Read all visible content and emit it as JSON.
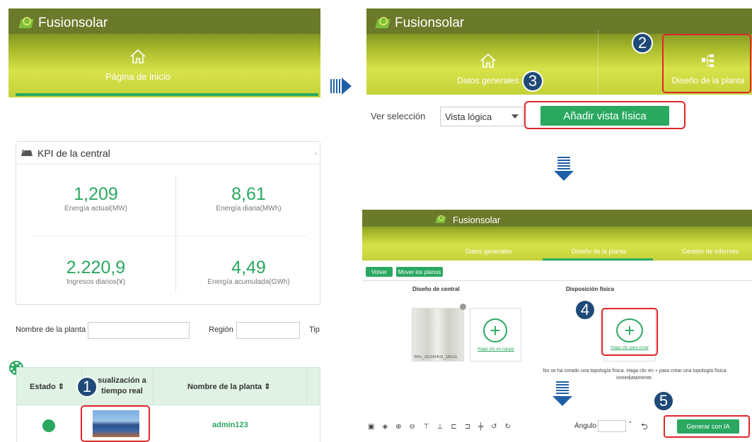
{
  "panel1": {
    "app_name": "Fusionsolar",
    "home_label": "Página de inicio",
    "kpi_title": "KPI de la central",
    "kpis": [
      {
        "value": "1,209",
        "label": "Energía actual(MW)"
      },
      {
        "value": "8,61",
        "label": "Energía diaria(MWh)"
      },
      {
        "value": "2.220,9",
        "label": "Ingresos diarios(¥)"
      },
      {
        "value": "4,49",
        "label": "Energía acumulada(GWh)"
      }
    ],
    "filter": {
      "plant_name_label": "Nombre de la planta",
      "region_label": "Región",
      "type_label": "Tip"
    },
    "table": {
      "headers": [
        "Estado",
        "Visualización a tiempo real",
        "Nombre de la planta"
      ],
      "header_visible": [
        "Estado ⇕",
        "sualización a\ntiempo real",
        "Nombre de la planta ⇕"
      ],
      "row": {
        "plant": "admin123"
      }
    }
  },
  "panel2": {
    "app_name": "Fusionsolar",
    "tab_overview": "Datos generales",
    "tab_design": "Diseño de la planta",
    "view_label": "Ver selección",
    "view_value": "Vista lógica",
    "add_button": "Añadir vista física"
  },
  "panel3": {
    "app_name": "Fusionsolar",
    "tabs": [
      "Datos generales",
      "Diseño de la planta",
      "Gestión de informes"
    ],
    "back_button": "Volver",
    "move_button": "Mover los planos",
    "plant_design_title": "Diseño de central",
    "physical_title": "Disposición física",
    "image_caption": "IMG_20200403_18521",
    "upload_link": "Haga clic en cargar",
    "create_link": "Haga clic para crear",
    "notice": "No se ha creado una topología física. Haga clic en + para crear una topología física inmediatamente."
  },
  "panel4": {
    "angle_label": "Ángulo",
    "degree": "°",
    "generate_button": "Generar con IA"
  },
  "steps": [
    "1",
    "2",
    "3",
    "4",
    "5"
  ]
}
